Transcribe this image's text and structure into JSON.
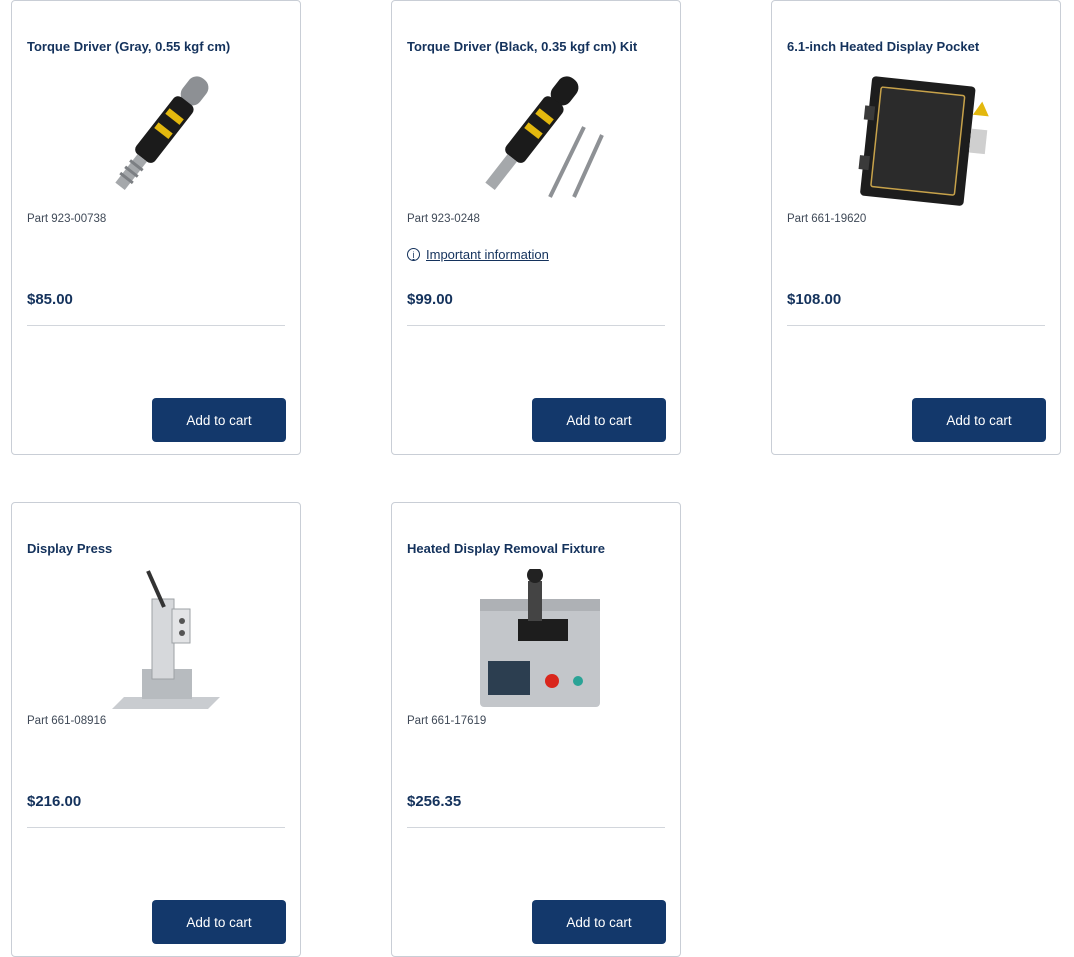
{
  "products": [
    {
      "title": "Torque Driver (Gray, 0.55 kgf cm)",
      "part": "Part 923-00738",
      "price": "$85.00",
      "button_label": "Add to cart"
    },
    {
      "title": "Torque Driver (Black, 0.35 kgf cm) Kit",
      "part": "Part 923-0248",
      "info_link": "Important information",
      "price": "$99.00",
      "button_label": "Add to cart"
    },
    {
      "title": "6.1-inch Heated Display Pocket",
      "part": "Part 661-19620",
      "price": "$108.00",
      "button_label": "Add to cart"
    },
    {
      "title": "Display Press",
      "part": "Part 661-08916",
      "price": "$216.00",
      "button_label": "Add to cart"
    },
    {
      "title": "Heated Display Removal Fixture",
      "part": "Part 661-17619",
      "price": "$256.35",
      "button_label": "Add to cart"
    }
  ],
  "colors": {
    "accent": "#13386b",
    "title": "#14325c",
    "border": "#c9ced6"
  }
}
